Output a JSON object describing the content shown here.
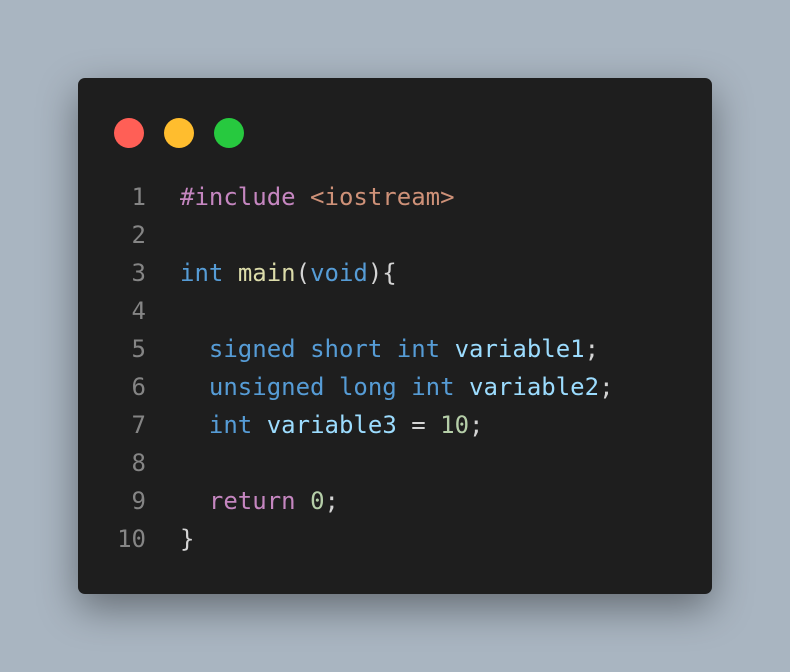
{
  "colors": {
    "background": "#a9b5c1",
    "editor": "#1e1e1e",
    "red": "#ff5f56",
    "yellow": "#ffbd2e",
    "green": "#27c93f"
  },
  "window_controls": [
    {
      "name": "close",
      "color": "#ff5f56"
    },
    {
      "name": "minimize",
      "color": "#ffbd2e"
    },
    {
      "name": "maximize",
      "color": "#27c93f"
    }
  ],
  "code": {
    "language": "cpp",
    "lines": [
      {
        "n": "1",
        "tokens": [
          {
            "t": "#include",
            "k": "directive"
          },
          {
            "t": " ",
            "k": "punct"
          },
          {
            "t": "<iostream>",
            "k": "string"
          }
        ]
      },
      {
        "n": "2",
        "tokens": []
      },
      {
        "n": "3",
        "tokens": [
          {
            "t": "int",
            "k": "keyword"
          },
          {
            "t": " ",
            "k": "punct"
          },
          {
            "t": "main",
            "k": "function"
          },
          {
            "t": "(",
            "k": "punct"
          },
          {
            "t": "void",
            "k": "keyword"
          },
          {
            "t": "){",
            "k": "punct"
          }
        ]
      },
      {
        "n": "4",
        "tokens": []
      },
      {
        "n": "5",
        "tokens": [
          {
            "t": "  ",
            "k": "punct"
          },
          {
            "t": "signed",
            "k": "keyword"
          },
          {
            "t": " ",
            "k": "punct"
          },
          {
            "t": "short",
            "k": "keyword"
          },
          {
            "t": " ",
            "k": "punct"
          },
          {
            "t": "int",
            "k": "keyword"
          },
          {
            "t": " ",
            "k": "punct"
          },
          {
            "t": "variable1",
            "k": "var"
          },
          {
            "t": ";",
            "k": "punct"
          }
        ]
      },
      {
        "n": "6",
        "tokens": [
          {
            "t": "  ",
            "k": "punct"
          },
          {
            "t": "unsigned",
            "k": "keyword"
          },
          {
            "t": " ",
            "k": "punct"
          },
          {
            "t": "long",
            "k": "keyword"
          },
          {
            "t": " ",
            "k": "punct"
          },
          {
            "t": "int",
            "k": "keyword"
          },
          {
            "t": " ",
            "k": "punct"
          },
          {
            "t": "variable2",
            "k": "var"
          },
          {
            "t": ";",
            "k": "punct"
          }
        ]
      },
      {
        "n": "7",
        "tokens": [
          {
            "t": "  ",
            "k": "punct"
          },
          {
            "t": "int",
            "k": "keyword"
          },
          {
            "t": " ",
            "k": "punct"
          },
          {
            "t": "variable3",
            "k": "var"
          },
          {
            "t": " = ",
            "k": "punct"
          },
          {
            "t": "10",
            "k": "number"
          },
          {
            "t": ";",
            "k": "punct"
          }
        ]
      },
      {
        "n": "8",
        "tokens": []
      },
      {
        "n": "9",
        "tokens": [
          {
            "t": "  ",
            "k": "punct"
          },
          {
            "t": "return",
            "k": "control"
          },
          {
            "t": " ",
            "k": "punct"
          },
          {
            "t": "0",
            "k": "number"
          },
          {
            "t": ";",
            "k": "punct"
          }
        ]
      },
      {
        "n": "10",
        "tokens": [
          {
            "t": "}",
            "k": "punct"
          }
        ]
      }
    ]
  }
}
